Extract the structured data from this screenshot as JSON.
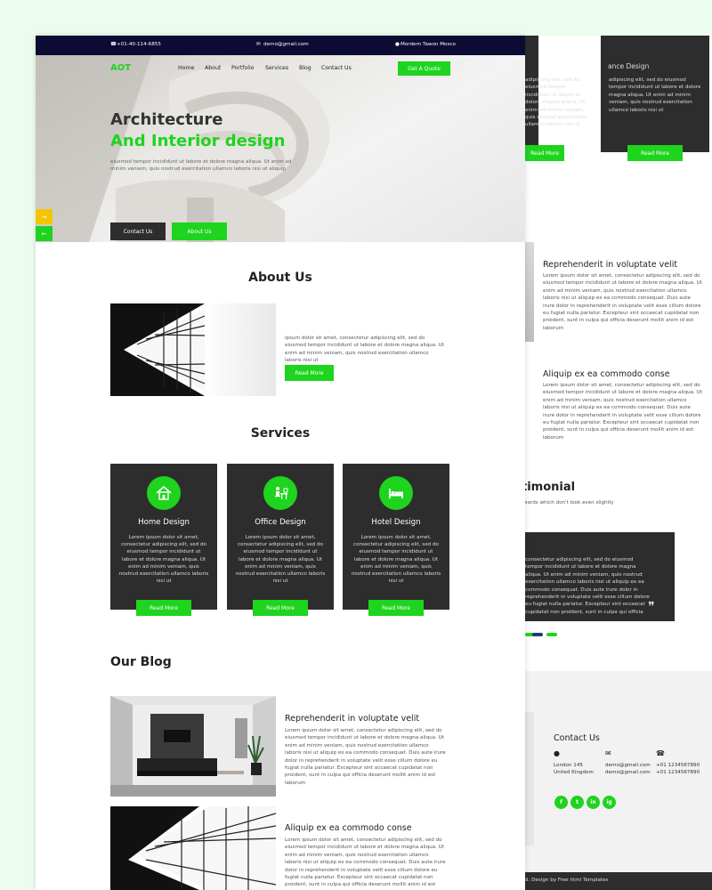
{
  "topbar": {
    "phone": "+01-40-114-6855",
    "email": "demo@gmail.com",
    "address": "Mordern Tawon Mosco"
  },
  "brand": {
    "logo": "AOT"
  },
  "nav": {
    "items": [
      "Home",
      "About",
      "Portfolio",
      "Services",
      "Blog",
      "Contact Us"
    ],
    "cta": "Get A Quote"
  },
  "hero": {
    "title_line1": "Architecture",
    "title_line2": "And Interior design",
    "text": "eiusmod tempor incididunt ut labore et dolore magna aliqua. Ut enim ad minim veniam, quis nostrud exercitation ullamco laboris nisi ut aliquip",
    "btn_contact": "Contact Us",
    "btn_about": "About Us",
    "side_arrow_next": "→",
    "side_arrow_prev": "←"
  },
  "about": {
    "title": "About Us",
    "text": "ipsum dolor sit amet, consectetur adipiscing elit, sed do eiusmod tempor incididunt ut labore et dolore magna aliqua. Ut enim ad minim veniam, quis nostrud exercitation ullamco laboris nisi ut",
    "button": "Read More"
  },
  "services": {
    "title": "Services",
    "cards": [
      {
        "icon": "home-icon",
        "title": "Home Design",
        "text": "Lorem ipsum dolor sit amet, consectetur adipiscing elit, sed do eiusmod tempor incididunt ut labore et dolore magna aliqua. Ut enim ad minim veniam, quis nostrud exercitation ullamco laboris nisi ut",
        "button": "Read More"
      },
      {
        "icon": "office-desk-icon",
        "title": "Office Design",
        "text": "Lorem ipsum dolor sit amet, consectetur adipiscing elit, sed do eiusmod tempor incididunt ut labore et dolore magna aliqua. Ut enim ad minim veniam, quis nostrud exercitation ullamco laboris nisi ut",
        "button": "Read More"
      },
      {
        "icon": "bed-icon",
        "title": "Hotel Design",
        "text": "Lorem ipsum dolor sit amet, consectetur adipiscing elit, sed do eiusmod tempor incididunt ut labore et dolore magna aliqua. Ut enim ad minim veniam, quis nostrud exercitation ullamco laboris nisi ut",
        "button": "Read More"
      }
    ]
  },
  "blog": {
    "title": "Our Blog",
    "posts": [
      {
        "title": "Reprehenderit in voluptate velit",
        "text": "Lorem ipsum dolor sit amet, consectetur adipiscing elit, sed do eiusmod tempor incididunt ut labore et dolore magna aliqua. Ut enim ad minim veniam, quis nostrud exercitation ullamco laboris nisi ut aliquip ex ea commodo consequat. Duis aute irure dolor in reprehenderit in voluptate velit esse cillum dolore eu fugiat nulla pariatur. Excepteur sint occaecat cupidatat non proident, sunt in culpa qui officia deserunt mollit anim id est laborum"
      },
      {
        "title": "Aliquip ex ea commodo conse",
        "text": "Lorem ipsum dolor sit amet, consectetur adipiscing elit, sed do eiusmod tempor incididunt ut labore et dolore magna aliqua. Ut enim ad minim veniam, quis nostrud exercitation ullamco laboris nisi ut aliquip ex ea commodo consequat. Duis aute irure dolor in reprehenderit in voluptate velit esse cillum dolore eu fugiat nulla pariatur. Excepteur sint occaecat cupidatat non proident, sunt in culpa qui officia deserunt mollit anim id est laborum"
      }
    ]
  },
  "back": {
    "card1_head": "g",
    "card2_head": "ance Design",
    "card_text": "adipiscing elit, sed do eiusmod tempor incididunt ut labore et dolore magna aliqua. Ut enim ad minim veniam, quis nostrud exercitation ullamco laboris nisi ut",
    "card_button": "Read More",
    "blog1_title": "Reprehenderit in voluptate velit",
    "blog2_title": "Aliquip ex ea commodo conse",
    "blog_text": "Lorem ipsum dolor sit amet, consectetur adipiscing elit, sed do eiusmod tempor incididunt ut labore et dolore magna aliqua. Ut enim ad minim veniam, quis nostrud exercitation ullamco laboris nisi ut aliquip ex ea commodo consequat. Duis aute irure dolor in reprehenderit in voluptate velit esse cillum dolore eu fugiat nulla pariatur. Excepteur sint occaecat cupidatat non proident, sunt in culpa qui officia deserunt mollit anim id est laborum",
    "testimonial_title": "timonial",
    "testimonial_sub": "words which don't look even slightly",
    "testimonial_text": "consectetur adipiscing elit, sed do eiusmod tempor incididunt ut labore et dolore magna aliqua. Ut enim ad minim veniam, quis nostrud exercitation ullamco laboris nisi ut aliquip ex ea commodo consequat. Duis aute irure dolor in reprehenderit in voluptate velit esse cillum dolore eu fugiat nulla pariatur. Excepteur sint occaecat cupidatat non proident, sunt in culpa qui officia",
    "quote_mark": "❞",
    "contact_title": "Contact Us",
    "address_lines": [
      "London 145",
      "United Kingdom"
    ],
    "email_lines": [
      "demo@gmail.com",
      "demo@gmail.com"
    ],
    "phone_lines": [
      "+01 1234567890",
      "+01 1234567890"
    ],
    "social": [
      "f",
      "t",
      "in",
      "ig"
    ],
    "copyright": "d. Design by Free html Templates"
  }
}
